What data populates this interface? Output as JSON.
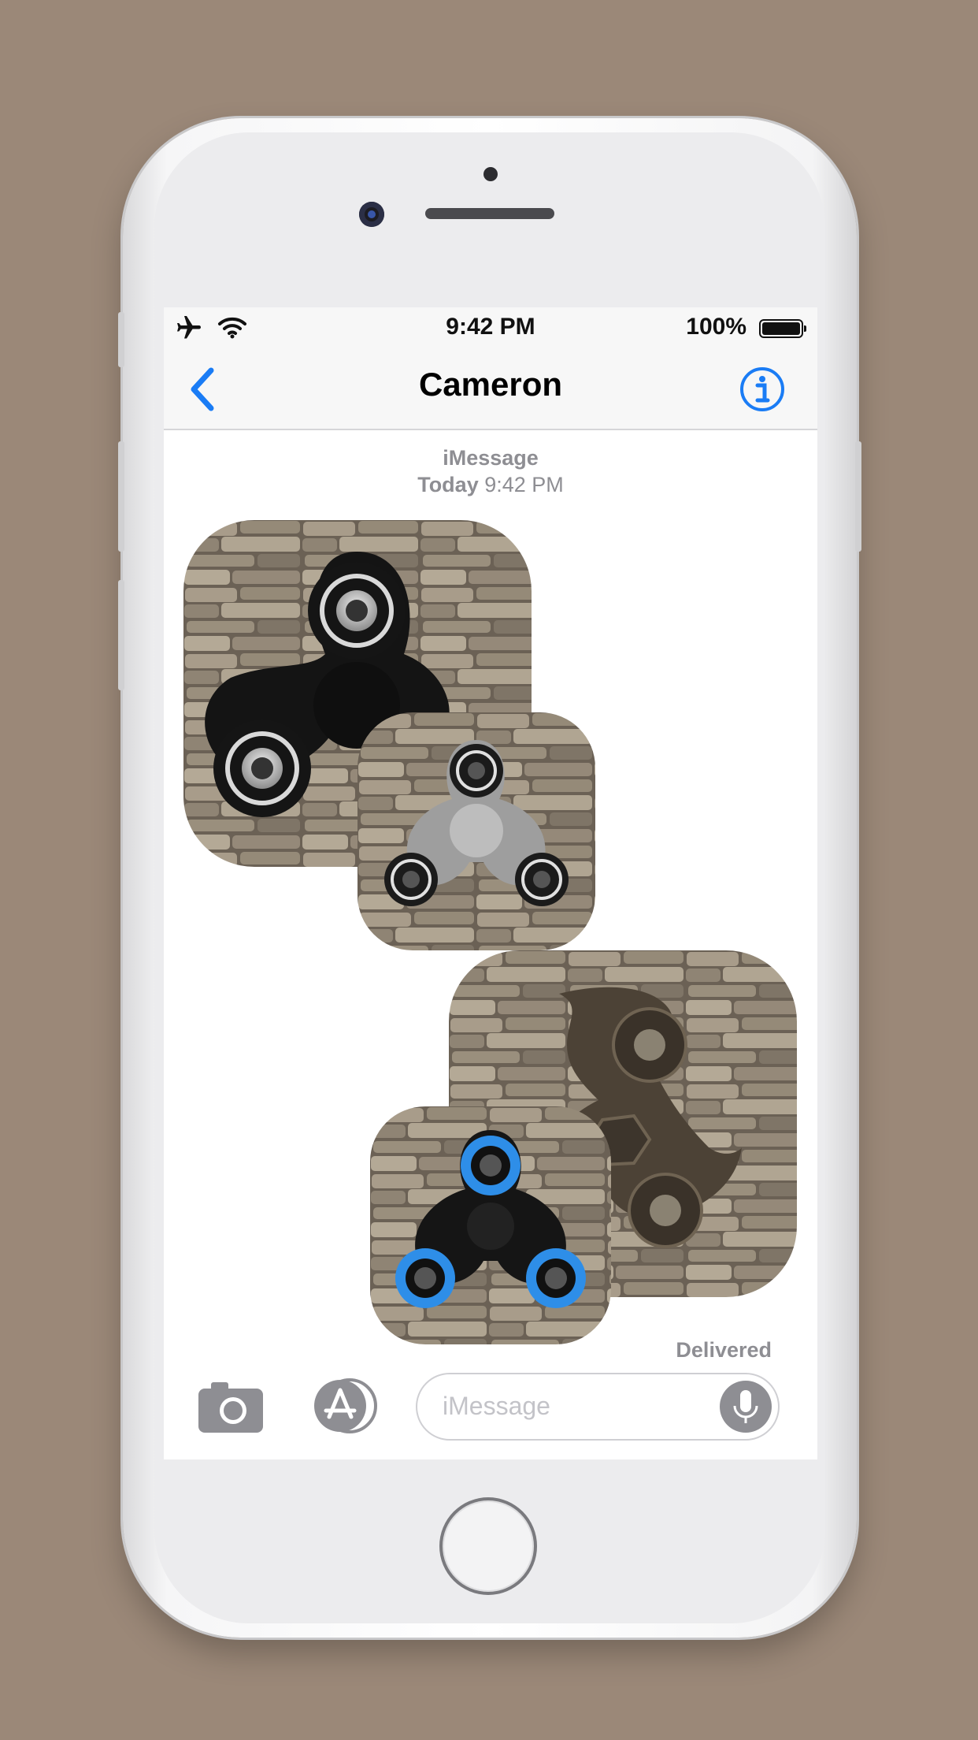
{
  "status_bar": {
    "time": "9:42 PM",
    "battery": "100%",
    "icons": [
      "airplane-icon",
      "wifi-icon",
      "battery-icon"
    ]
  },
  "nav": {
    "back_icon": "chevron-left-icon",
    "contact_name": "Cameron",
    "info_icon": "info-icon",
    "accent": "#1a7cf5"
  },
  "conversation": {
    "service": "iMessage",
    "day": "Today",
    "time": "9:42 PM",
    "stickers": [
      {
        "name": "black fidget spinner sticker"
      },
      {
        "name": "gray fidget spinner sticker"
      },
      {
        "name": "bronze fidget spinner sticker"
      },
      {
        "name": "blue fidget spinner sticker"
      }
    ],
    "status": "Delivered"
  },
  "input": {
    "placeholder": "iMessage",
    "camera_icon": "camera-icon",
    "app_store_icon": "app-store-icon",
    "mic_icon": "microphone-icon"
  }
}
